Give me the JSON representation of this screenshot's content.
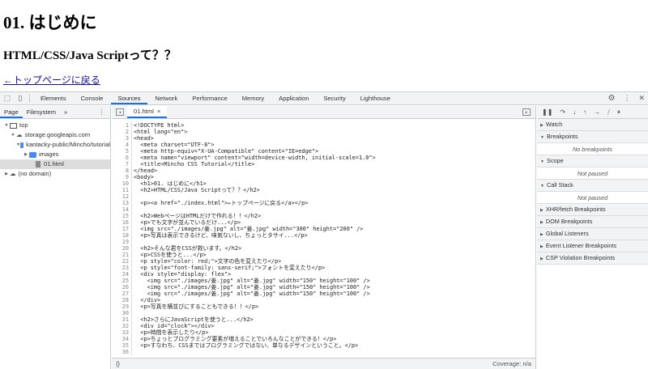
{
  "page": {
    "h1": "01. はじめに",
    "h2": "HTML/CSS/Java Scriptって？？",
    "link": "←トップページに戻る"
  },
  "devtools": {
    "tabs": [
      "Elements",
      "Console",
      "Sources",
      "Network",
      "Performance",
      "Memory",
      "Application",
      "Security",
      "Lighthouse"
    ],
    "active_tab": "Sources",
    "navigator": {
      "tabs": [
        "Page",
        "Filesystem"
      ],
      "more": "»",
      "tree": [
        {
          "label": "top",
          "expanded": true
        },
        {
          "label": "storage.googleapis.com",
          "expanded": true
        },
        {
          "label": "kantacky-public/Mincho/tutorial",
          "expanded": true
        },
        {
          "label": "images",
          "expanded": false
        },
        {
          "label": "01.html",
          "selected": true
        },
        {
          "label": "(no domain)",
          "expanded": false
        }
      ]
    },
    "editor": {
      "file_tab": "01.html",
      "close": "×",
      "format_button": "{}",
      "coverage": "Coverage: n/a",
      "lines": [
        "<!DOCTYPE html>",
        "<html lang=\"en\">",
        "<head>",
        "  <meta charset=\"UTF-8\">",
        "  <meta http-equiv=\"X-UA-Compatible\" content=\"IE=edge\">",
        "  <meta name=\"viewport\" content=\"width=device-width, initial-scale=1.0\">",
        "  <title>Mincho CSS Tutorial</title>",
        "</head>",
        "<body>",
        "  <h1>01. はじめに</h1>",
        "  <h2>HTML/CSS/Java Scriptって？？</h2>",
        "",
        "  <p><a href=\"./index.html\">←トップページに戻る</a></p>",
        "",
        "  <h2>WebページはHTMLだけで作れる！！</h2>",
        "  <p>でも文字が並んでいるだけ...</p>",
        "  <img src=\"./images/姜.jpg\" alt=\"姜.jpg\" width=\"300\" height=\"200\" />",
        "  <p>写真は表示できるけど、味気ないし、ちょっとタサイ...</p>",
        "",
        "  <h2>そんな君をCSSが救います。</h2>",
        "  <p>CSSを使うと...</p>",
        "  <p style=\"color: red;\">文字の色を変えたり</p>",
        "  <p style=\"font-family: sans-serif;\">フォントを変えたり</p>",
        "  <div style=\"display: flex\">",
        "    <img src=\"./images/姜.jpg\" alt=\"姜.jpg\" width=\"150\" height=\"100\" />",
        "    <img src=\"./images/姜.jpg\" alt=\"姜.jpg\" width=\"150\" height=\"100\" />",
        "    <img src=\"./images/姜.jpg\" alt=\"姜.jpg\" width=\"150\" height=\"100\" />",
        "  </div>",
        "  <p>写真を横並びにすることもできる！！</p>",
        "",
        "  <h2>さらにJavaScriptを使うと...</h2>",
        "  <div id=\"clock\"></div>",
        "  <p>時間を表示したり</p>",
        "  <p>ちょっとプログラミング要素が増えることでいろんなことができる！</p>",
        "  <p>すなわち、CSSまではプログラミングではない、単なるデザインということ。</p>",
        ""
      ]
    },
    "debugger": {
      "sections": [
        {
          "label": "Watch",
          "expanded": false
        },
        {
          "label": "Breakpoints",
          "expanded": true,
          "body": "No breakpoints"
        },
        {
          "label": "Scope",
          "expanded": true,
          "body": "Not paused"
        },
        {
          "label": "Call Stack",
          "expanded": true,
          "body": "Not paused"
        },
        {
          "label": "XHR/fetch Breakpoints",
          "expanded": false
        },
        {
          "label": "DOM Breakpoints",
          "expanded": false
        },
        {
          "label": "Global Listeners",
          "expanded": false
        },
        {
          "label": "Event Listener Breakpoints",
          "expanded": false
        },
        {
          "label": "CSP Violation Breakpoints",
          "expanded": false
        }
      ]
    },
    "accent": "#1a73e8"
  }
}
